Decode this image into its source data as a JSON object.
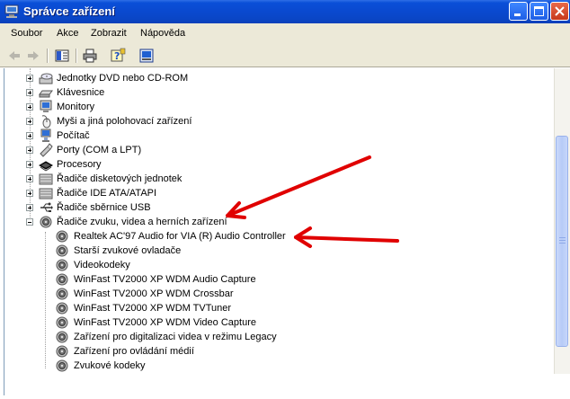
{
  "window": {
    "title": "Správce zařízení"
  },
  "menu": [
    {
      "label": "Soubor"
    },
    {
      "label": "Akce"
    },
    {
      "label": "Zobrazit"
    },
    {
      "label": "Nápověda"
    }
  ],
  "tree": {
    "collapsed_categories": [
      {
        "label": "Jednotky DVD nebo CD-ROM",
        "icon": "cdrom-icon"
      },
      {
        "label": "Klávesnice",
        "icon": "keyboard-icon"
      },
      {
        "label": "Monitory",
        "icon": "monitor-icon"
      },
      {
        "label": "Myši a jiná polohovací zařízení",
        "icon": "mouse-icon"
      },
      {
        "label": "Počítač",
        "icon": "computer-icon"
      },
      {
        "label": "Porty (COM a LPT)",
        "icon": "port-icon"
      },
      {
        "label": "Procesory",
        "icon": "cpu-icon"
      },
      {
        "label": "Řadiče disketových jednotek",
        "icon": "floppy-controller-icon"
      },
      {
        "label": "Řadiče IDE ATA/ATAPI",
        "icon": "ide-controller-icon"
      },
      {
        "label": "Řadiče sběrnice USB",
        "icon": "usb-icon"
      }
    ],
    "expanded_category": {
      "label": "Řadiče zvuku, videa a herních zařízení",
      "icon": "sound-icon"
    },
    "devices": [
      {
        "label": "Realtek AC'97 Audio for VIA (R) Audio Controller"
      },
      {
        "label": "Starší zvukové ovladače"
      },
      {
        "label": "Videokodeky"
      },
      {
        "label": "WinFast TV2000 XP WDM Audio Capture"
      },
      {
        "label": "WinFast TV2000 XP WDM Crossbar"
      },
      {
        "label": "WinFast TV2000 XP WDM TVTuner"
      },
      {
        "label": "WinFast TV2000 XP WDM Video Capture"
      },
      {
        "label": "Zařízení pro digitalizaci videa v režimu Legacy"
      },
      {
        "label": "Zařízení pro ovládání médií"
      },
      {
        "label": "Zvukové kodeky"
      }
    ]
  },
  "colors": {
    "titlebar": "#0a4fd8",
    "annotation_arrow": "#e00000"
  }
}
